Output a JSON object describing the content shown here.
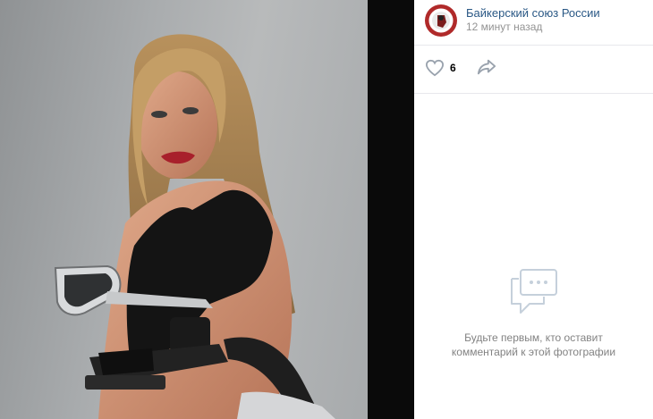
{
  "post": {
    "author": "Байкерский союз России",
    "time": "12 минут назад"
  },
  "actions": {
    "like_count": "6"
  },
  "comments": {
    "empty_line1": "Будьте первым, кто оставит",
    "empty_line2": "комментарий к этой фотографии"
  },
  "icons": {
    "like": "heart-icon",
    "share": "share-arrow-icon",
    "empty": "chat-bubble-icon"
  },
  "colors": {
    "link": "#2a5885",
    "muted": "#939393",
    "icon": "#99a2ad",
    "empty_icon": "#c5d0db"
  }
}
